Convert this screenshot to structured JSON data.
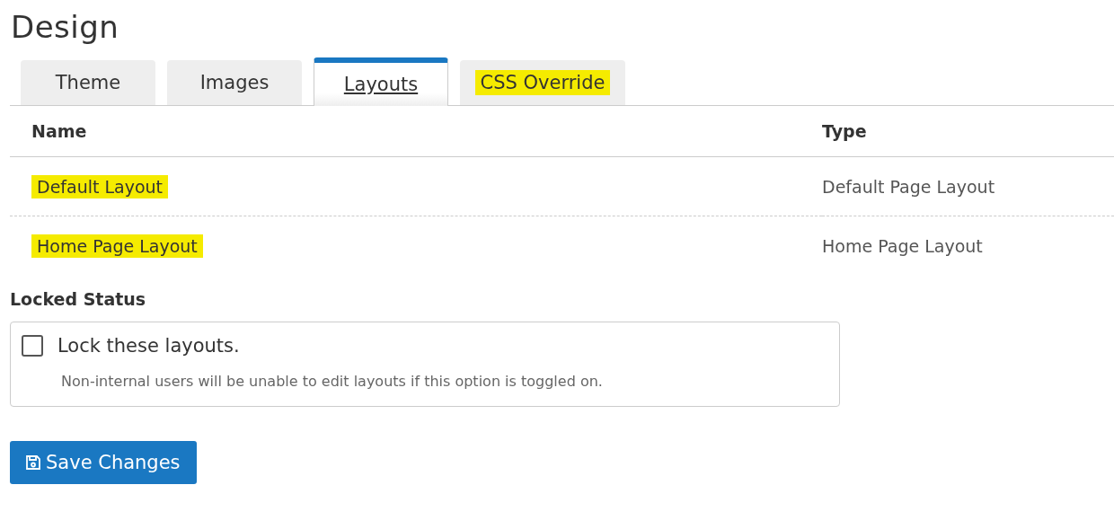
{
  "title": "Design",
  "tabs": [
    {
      "label": "Theme",
      "selected": false,
      "highlighted": false
    },
    {
      "label": "Images",
      "selected": false,
      "highlighted": false
    },
    {
      "label": "Layouts",
      "selected": true,
      "highlighted": false
    },
    {
      "label": "CSS Override",
      "selected": false,
      "highlighted": true
    }
  ],
  "table": {
    "columns": [
      "Name",
      "Type"
    ],
    "rows": [
      {
        "name": "Default Layout",
        "type": "Default Page Layout",
        "highlighted": true
      },
      {
        "name": "Home Page Layout",
        "type": "Home Page Layout",
        "highlighted": true
      }
    ]
  },
  "locked": {
    "heading": "Locked Status",
    "label": "Lock these layouts.",
    "checked": false,
    "help": "Non-internal users will be unable to edit layouts if this option is toggled on."
  },
  "save_button": "Save Changes"
}
